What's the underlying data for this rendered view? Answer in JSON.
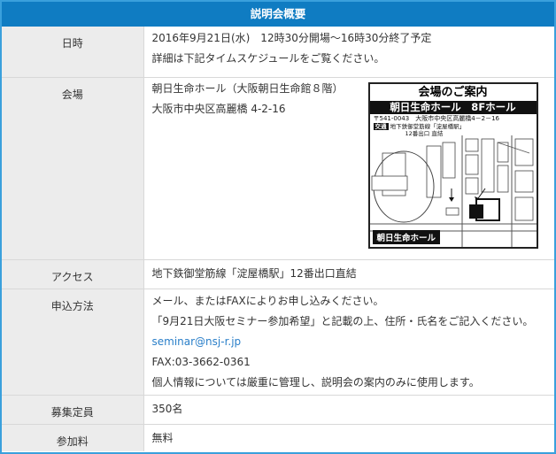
{
  "section_title": "説明会概要",
  "rows": {
    "datetime": {
      "label": "日時",
      "lines": [
        "2016年9月21日(水)　12時30分開場～16時30分終了予定",
        "詳細は下記タイムスケジュールをご覧ください。"
      ]
    },
    "venue": {
      "label": "会場",
      "lines": [
        "朝日生命ホール（大阪朝日生命館８階）",
        "大阪市中央区高麗橋 4-2-16"
      ],
      "map": {
        "heading": "会場のご案内",
        "hall": "朝日生命ホール　8Fホール",
        "address": "〒541-0043　大阪市中央区高麗橋4－2－16",
        "access_tag": "交通",
        "access_line1": "地下鉄御堂筋線「淀屋橋駅」",
        "access_line2": "12番出口 直結",
        "label": "朝日生命ホール"
      }
    },
    "access": {
      "label": "アクセス",
      "text": "地下鉄御堂筋線「淀屋橋駅」12番出口直結"
    },
    "apply": {
      "label": "申込方法",
      "line1": "メール、またはFAXによりお申し込みください。",
      "line2": "「9月21日大阪セミナー参加希望」と記載の上、住所・氏名をご記入ください。",
      "email": "seminar@nsj-r.jp",
      "fax": "FAX:03-3662-0361",
      "line5": "個人情報については厳重に管理し、説明会の案内のみに使用します。"
    },
    "capacity": {
      "label": "募集定員",
      "value": "350名"
    },
    "fee": {
      "label": "参加料",
      "value": "無料"
    }
  },
  "colors": {
    "header_bg": "#0f7cc2",
    "frame_border": "#3aa0dc",
    "label_bg": "#ececec",
    "link": "#2a7fc9"
  }
}
